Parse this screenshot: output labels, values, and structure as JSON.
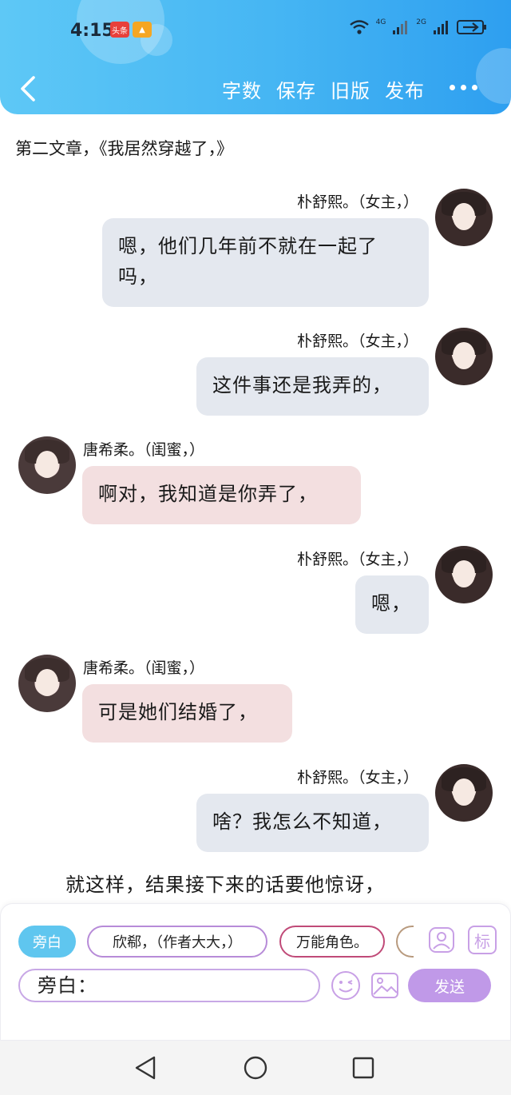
{
  "status_bar": {
    "time": "4:15",
    "badge_text": "头条",
    "network1": "4G",
    "network2": "2G"
  },
  "toolbar": {
    "actions": [
      "字数",
      "保存",
      "旧版",
      "发布"
    ]
  },
  "chapter_title": "第二文章，《我居然穿越了，》",
  "messages": [
    {
      "side": "right",
      "speaker": "朴舒熙。（女主，）",
      "text": "嗯，他们几年前不就在一起了吗，",
      "line1": "嗯，他们几年前不就在一起了",
      "line2": "吗，",
      "bubble_color": "#e4e8ef"
    },
    {
      "side": "right",
      "speaker": "朴舒熙。（女主，）",
      "text": "这件事还是我弄的，",
      "bubble_color": "#e4e8ef"
    },
    {
      "side": "left",
      "speaker": "唐希柔。（闺蜜，）",
      "text": "啊对，我知道是你弄了，",
      "bubble_color": "#f3dfe0"
    },
    {
      "side": "right",
      "speaker": "朴舒熙。（女主，）",
      "text": "嗯，",
      "bubble_color": "#e4e8ef"
    },
    {
      "side": "left",
      "speaker": "唐希柔。（闺蜜，）",
      "text": "可是她们结婚了，",
      "bubble_color": "#f3dfe0"
    },
    {
      "side": "right",
      "speaker": "朴舒熙。（女主，）",
      "text": "啥？我怎么不知道，",
      "bubble_color": "#e4e8ef"
    }
  ],
  "narration": "就这样，结果接下来的话要他惊讶，",
  "input_panel": {
    "roles": [
      "旁白",
      "欣郗，（作者大大，）",
      "万能角色。"
    ],
    "role_icons": [
      "contact-icon",
      "tag-icon"
    ],
    "tag_label": "标",
    "input_value": "旁白：",
    "send_label": "发送",
    "accent_color": "#c099e8",
    "narration_chip_color": "#5fc6ef"
  },
  "system_nav": {
    "icons": [
      "back-triangle-icon",
      "home-circle-icon",
      "recents-square-icon"
    ]
  }
}
